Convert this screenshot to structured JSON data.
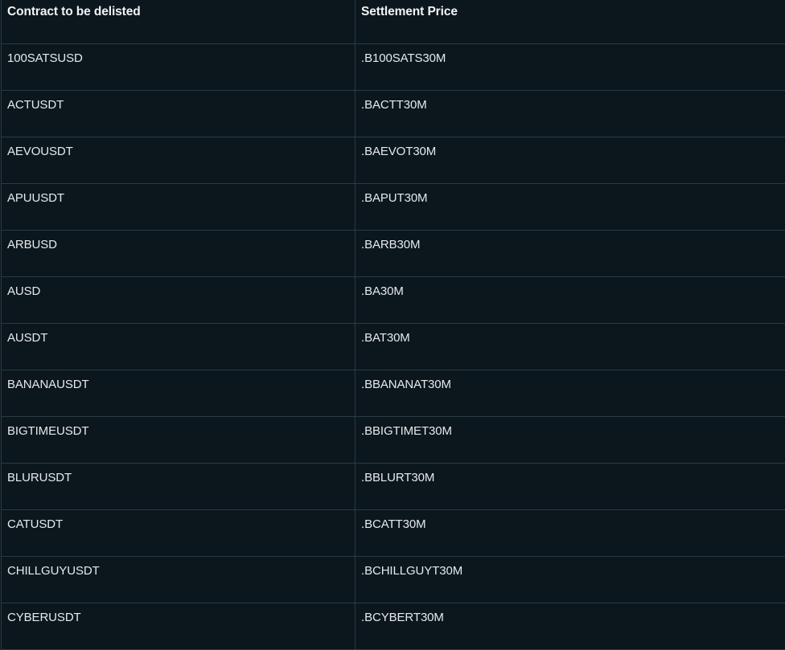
{
  "table": {
    "headers": [
      "Contract to be delisted",
      "Settlement Price"
    ],
    "rows": [
      [
        "100SATSUSD",
        ".B100SATS30M"
      ],
      [
        "ACTUSDT",
        ".BACTT30M"
      ],
      [
        "AEVOUSDT",
        ".BAEVOT30M"
      ],
      [
        "APUUSDT",
        ".BAPUT30M"
      ],
      [
        "ARBUSD",
        ".BARB30M"
      ],
      [
        "AUSD",
        ".BA30M"
      ],
      [
        "AUSDT",
        ".BAT30M"
      ],
      [
        "BANANAUSDT",
        ".BBANANAT30M"
      ],
      [
        "BIGTIMEUSDT",
        ".BBIGTIMET30M"
      ],
      [
        "BLURUSDT",
        ".BBLURT30M"
      ],
      [
        "CATUSDT",
        ".BCATT30M"
      ],
      [
        "CHILLGUYUSDT",
        ".BCHILLGUYT30M"
      ],
      [
        "CYBERUSDT",
        ".BCYBERT30M"
      ]
    ]
  }
}
